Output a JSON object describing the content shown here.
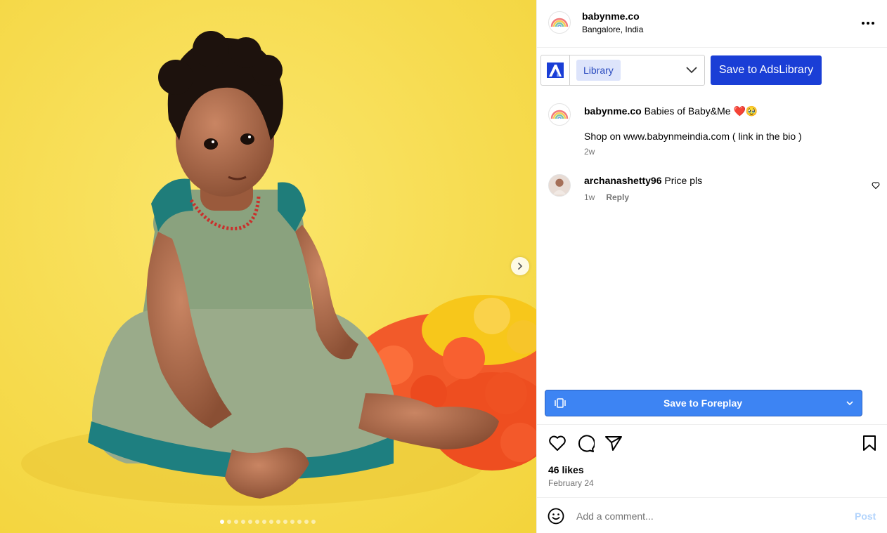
{
  "header": {
    "username": "babynme.co",
    "location": "Bangalore, India",
    "more_icon": "more-horizontal-icon"
  },
  "ads_library": {
    "selected": "Library",
    "save_label": "Save to AdsLibrary"
  },
  "caption": {
    "username": "babynme.co",
    "text": "Babies of Baby&Me ❤️🥹",
    "line2": "Shop on www.babynmeindia.com ( link in the bio )",
    "time": "2w"
  },
  "comments": [
    {
      "username": "archanashetty96",
      "text": "Price pls",
      "time": "1w",
      "reply_label": "Reply"
    }
  ],
  "foreplay": {
    "label": "Save to Foreplay"
  },
  "post": {
    "likes": "46 likes",
    "date": "February 24",
    "carousel_count": 14,
    "carousel_active": 0
  },
  "add_comment": {
    "placeholder": "Add a comment...",
    "post_label": "Post"
  },
  "colors": {
    "background_yellow": "#f7de52",
    "ads_blue": "#1a3ed6",
    "foreplay_blue": "#3d84f3"
  }
}
